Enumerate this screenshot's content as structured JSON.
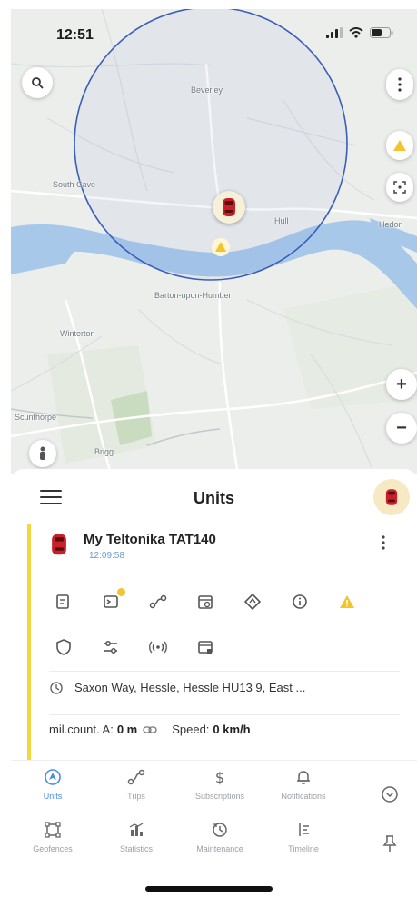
{
  "status_bar": {
    "time": "12:51"
  },
  "map": {
    "labels": {
      "beverley": "Beverley",
      "south_cave": "South Cave",
      "hull": "Hull",
      "barton": "Barton-upon-Humber",
      "winterton": "Winterton",
      "scunthorpe": "Scunthorpe",
      "brigg": "Brigg",
      "hedon": "Hedon"
    },
    "zoom_in": "+",
    "zoom_out": "−"
  },
  "panel": {
    "title": "Units",
    "unit": {
      "name": "My Teltonika TAT140",
      "time": "12:09:58",
      "address": "Saxon Way, Hessle, Hessle HU13 9, East ...",
      "mileage_label": "mil.count. A:",
      "mileage_value": "0 m",
      "speed_label": "Speed:",
      "speed_value": "0 km/h"
    }
  },
  "bottom_nav": {
    "items": [
      {
        "label": "Units",
        "icon": "units-icon"
      },
      {
        "label": "Trips",
        "icon": "trips-icon"
      },
      {
        "label": "Subscriptions",
        "icon": "dollar-icon"
      },
      {
        "label": "Notifications",
        "icon": "bell-icon"
      },
      {
        "label": "Geofences",
        "icon": "geofence-icon"
      },
      {
        "label": "Statistics",
        "icon": "statistics-icon"
      },
      {
        "label": "Maintenance",
        "icon": "maintenance-icon"
      },
      {
        "label": "Timeline",
        "icon": "timeline-icon"
      }
    ]
  },
  "colors": {
    "accent": "#4a8be8",
    "unit_stripe": "#f4d73b",
    "car_red": "#c8202a",
    "warning": "#f4c430",
    "circle": "#3a5fb8",
    "water": "#a8c8ea"
  }
}
